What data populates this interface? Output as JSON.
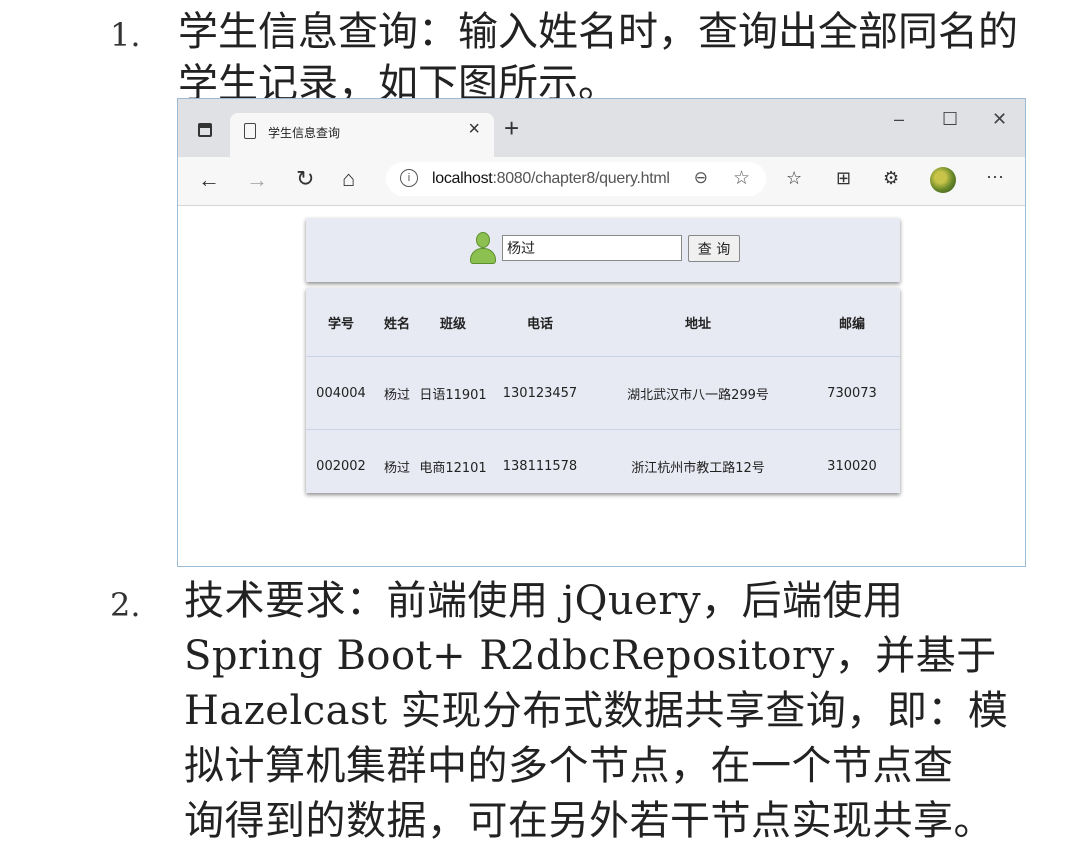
{
  "item1": {
    "number": "1.",
    "text": "学生信息查询：输入姓名时，查询出全部同名的学生记录，如下图所示。"
  },
  "browser": {
    "tab_title": "学生信息查询",
    "tab_close": "×",
    "new_tab": "+",
    "window_controls": {
      "minimize": "–",
      "maximize": "☐",
      "close": "✕"
    },
    "url_host": "localhost",
    "url_path": ":8080/chapter8/query.html",
    "icons": [
      "tab-actions-icon",
      "page-icon",
      "back-icon",
      "forward-icon",
      "refresh-icon",
      "home-icon",
      "info-icon",
      "zoom-icon",
      "favorite-add-icon",
      "favorites-icon",
      "collections-icon",
      "extensions-icon",
      "profile-avatar-icon",
      "more-icon",
      "user-icon"
    ]
  },
  "search": {
    "value": "杨过",
    "button_label": "查 询"
  },
  "table": {
    "headers": [
      "学号",
      "姓名",
      "班级",
      "电话",
      "地址",
      "邮编"
    ],
    "rows": [
      [
        "004004",
        "杨过",
        "日语11901",
        "130123457",
        "湖北武汉市八一路299号",
        "730073"
      ],
      [
        "002002",
        "杨过",
        "电商12101",
        "138111578",
        "浙江杭州市教工路12号",
        "310020"
      ]
    ]
  },
  "item2": {
    "number": "2.",
    "lines": [
      "技术要求：前端使用 jQuery，后端使用",
      "Spring  Boot+  R2dbcRepository，并基于",
      "Hazelcast 实现分布式数据共享查询，即：模",
      "拟计算机集群中的多个节点，在一个节点查",
      "询得到的数据，可在另外若干节点实现共享。"
    ]
  }
}
